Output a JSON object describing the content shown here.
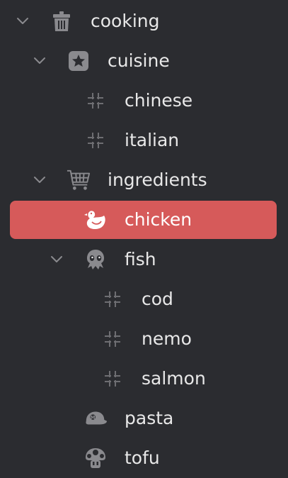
{
  "tree": {
    "cooking": {
      "label": "cooking",
      "icon": "trash-can-icon",
      "expanded": true
    },
    "cuisine": {
      "label": "cuisine",
      "icon": "star-box-icon",
      "expanded": true
    },
    "chinese": {
      "label": "chinese",
      "icon": "hashtag-icon"
    },
    "italian": {
      "label": "italian",
      "icon": "hashtag-icon"
    },
    "ingredients": {
      "label": "ingredients",
      "icon": "shopping-cart-icon",
      "expanded": true
    },
    "chicken": {
      "label": "chicken",
      "icon": "duck-icon",
      "selected": true
    },
    "fish": {
      "label": "fish",
      "icon": "squid-icon",
      "expanded": true
    },
    "cod": {
      "label": "cod",
      "icon": "hashtag-icon"
    },
    "nemo": {
      "label": "nemo",
      "icon": "hashtag-icon"
    },
    "salmon": {
      "label": "salmon",
      "icon": "hashtag-icon"
    },
    "pasta": {
      "label": "pasta",
      "icon": "cap-icon"
    },
    "tofu": {
      "label": "tofu",
      "icon": "mushroom-icon"
    }
  },
  "colors": {
    "background": "#2b2c30",
    "selection": "#d65a5a",
    "text": "#e8e8e8",
    "icon": "#8a8a8e",
    "chevron": "#8a8a8e"
  }
}
